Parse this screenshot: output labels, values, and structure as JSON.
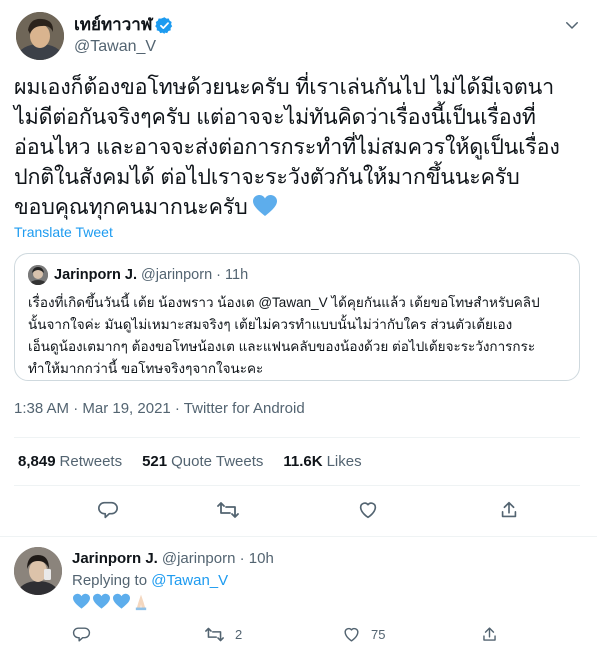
{
  "main_tweet": {
    "author": {
      "display_name": "เทย์ทาวาฬ",
      "handle": "@Tawan_V",
      "verified": true
    },
    "text_lines": [
      "ผมเองก็ต้องขอโทษด้วยนะครับ ที่เราเล่นกันไป ไม่ได้มีเจตนา",
      "ไม่ดีต่อกันจริงๆครับ แต่อาจจะไม่ทันคิดว่าเรื่องนี้เป็นเรื่องที่",
      "อ่อนไหว และอาจจะส่งต่อการกระทำที่ไม่สมควรให้ดูเป็นเรื่อง",
      "ปกติในสังคมได้  ต่อไปเราจะระวังตัวกันให้มากขึ้นนะครับ",
      "ขอบคุณทุกคนมากนะครับ"
    ],
    "translate_label": "Translate Tweet",
    "quoted_tweet": {
      "display_name": "Jarinporn J.",
      "handle_time": "@jarinporn · 11h",
      "text_lines": [
        "เรื่องที่เกิดขึ้นวันนี้ เต้ย น้องพราว น้องเต @Tawan_V ได้คุยกันแล้ว เต้ยขอโทษสำหรับคลิป",
        "นั้นจากใจค่ะ มันดูไม่เหมาะสมจริงๆ เต้ยไม่ควรทำแบบนั้นไม่ว่ากับใคร ส่วนตัวเต้ยเอง",
        "เอ็นดูน้องเตมากๆ ต้องขอโทษน้องเต และแฟนคลับของน้องด้วย ต่อไปเต้ยจะระวังการกระ",
        "ทำให้มากกว่านี้ ขอโทษจริงๆจากใจนะคะ"
      ]
    },
    "meta": "1:38 AM · Mar 19, 2021 · Twitter for Android",
    "stats": [
      {
        "value": "8,849",
        "label": "Retweets"
      },
      {
        "value": "521",
        "label": "Quote Tweets"
      },
      {
        "value": "11.6K",
        "label": "Likes"
      }
    ],
    "icons": {
      "verified": "verified-badge-icon",
      "more": "chevron-down-icon",
      "reply": "reply-icon",
      "retweet": "retweet-icon",
      "like": "heart-icon",
      "share": "share-icon",
      "emoji": "blue-heart-emoji"
    }
  },
  "reply_tweet": {
    "display_name": "Jarinporn J.",
    "handle_time": "@jarinporn · 10h",
    "replying_prefix": "Replying to",
    "replying_to": "@Tawan_V",
    "emojis": [
      "blue-heart-emoji",
      "blue-heart-emoji",
      "blue-heart-emoji",
      "folded-hands-emoji"
    ],
    "retweet_count": "2",
    "like_count": "75"
  },
  "colors": {
    "accent": "#1d9bf0",
    "text": "#0f1419",
    "muted": "#536471",
    "border": "#cfd9de",
    "heart_emoji": "#5dadec"
  }
}
